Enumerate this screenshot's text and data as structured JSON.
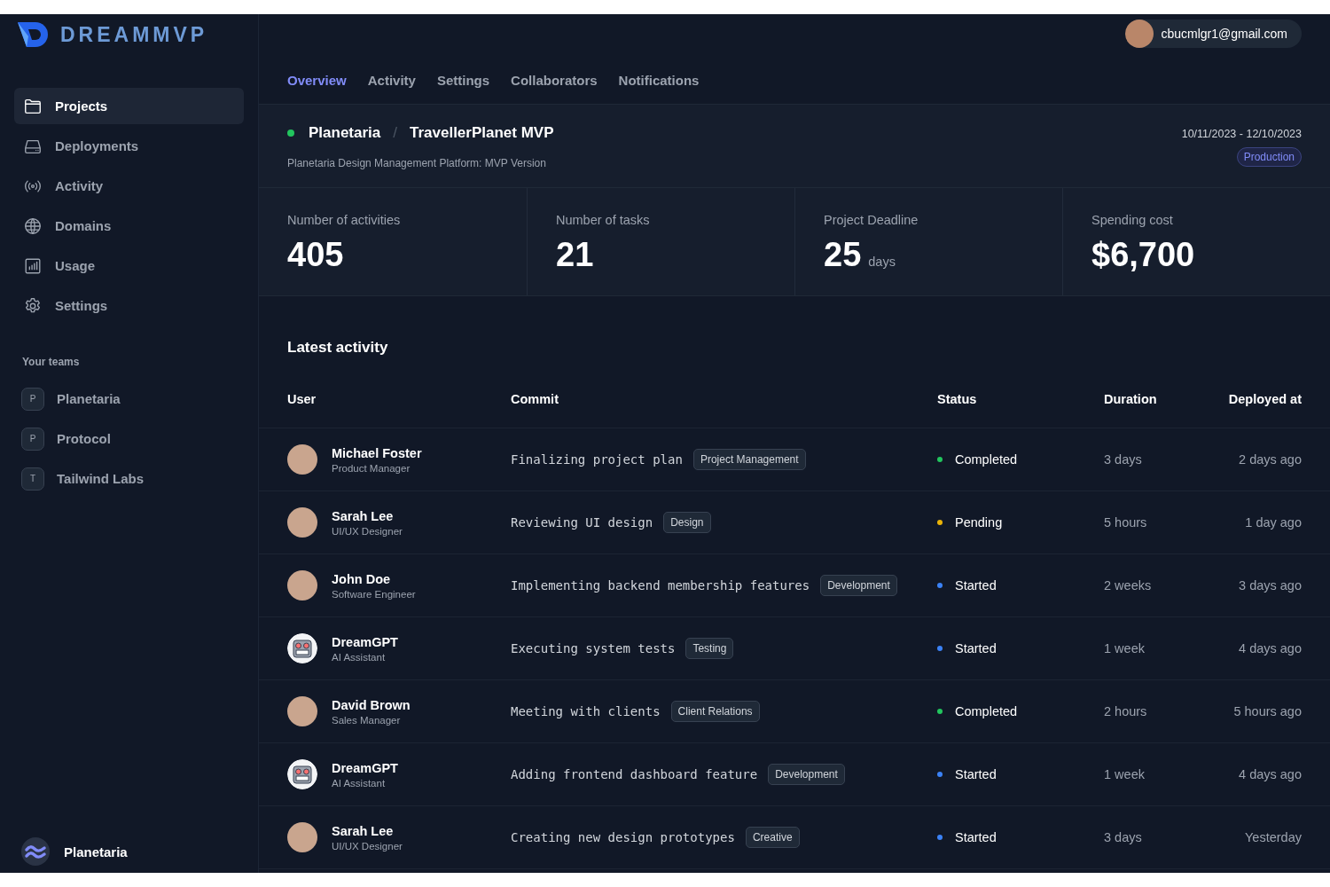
{
  "logo": {
    "text": "DREAMMVP"
  },
  "user_menu": {
    "email": "cbucmlgr1@gmail.com"
  },
  "sidebar": {
    "items": [
      {
        "label": "Projects",
        "selected": true
      },
      {
        "label": "Deployments",
        "selected": false
      },
      {
        "label": "Activity",
        "selected": false
      },
      {
        "label": "Domains",
        "selected": false
      },
      {
        "label": "Usage",
        "selected": false
      },
      {
        "label": "Settings",
        "selected": false
      }
    ],
    "teams_heading": "Your teams",
    "teams": [
      {
        "initial": "P",
        "name": "Planetaria"
      },
      {
        "initial": "P",
        "name": "Protocol"
      },
      {
        "initial": "T",
        "name": "Tailwind Labs"
      }
    ],
    "footer_team": "Planetaria"
  },
  "tabs": [
    {
      "label": "Overview",
      "selected": true
    },
    {
      "label": "Activity",
      "selected": false
    },
    {
      "label": "Settings",
      "selected": false
    },
    {
      "label": "Collaborators",
      "selected": false
    },
    {
      "label": "Notifications",
      "selected": false
    }
  ],
  "project": {
    "team": "Planetaria",
    "separator": "/",
    "name": "TravellerPlanet MVP",
    "description": "Planetaria Design Management Platform: MVP Version",
    "dates": "10/11/2023 - 12/10/2023",
    "environment": "Production"
  },
  "stats": [
    {
      "label": "Number of activities",
      "value": "405"
    },
    {
      "label": "Number of tasks",
      "value": "21"
    },
    {
      "label": "Project Deadline",
      "value": "25",
      "unit": "days"
    },
    {
      "label": "Spending cost",
      "value": "$6,700"
    }
  ],
  "activity": {
    "title": "Latest activity",
    "columns": [
      "User",
      "Commit",
      "Status",
      "Duration",
      "Deployed at"
    ],
    "rows": [
      {
        "kind": "person",
        "name": "Michael Foster",
        "role": "Product Manager",
        "commit": "Finalizing project plan",
        "tag": "Project Management",
        "status": "Completed",
        "color": "#22c55e",
        "duration": "3 days",
        "deployed": "2 days ago"
      },
      {
        "kind": "person",
        "name": "Sarah Lee",
        "role": "UI/UX Designer",
        "commit": "Reviewing UI design",
        "tag": "Design",
        "status": "Pending",
        "color": "#eab308",
        "duration": "5 hours",
        "deployed": "1 day ago"
      },
      {
        "kind": "person",
        "name": "John Doe",
        "role": "Software Engineer",
        "commit": "Implementing backend membership features",
        "tag": "Development",
        "status": "Started",
        "color": "#3b82f6",
        "duration": "2 weeks",
        "deployed": "3 days ago"
      },
      {
        "kind": "assistant",
        "name": "DreamGPT",
        "role": "AI Assistant",
        "commit": "Executing system tests",
        "tag": "Testing",
        "status": "Started",
        "color": "#3b82f6",
        "duration": "1 week",
        "deployed": "4 days ago"
      },
      {
        "kind": "person",
        "name": "David Brown",
        "role": "Sales Manager",
        "commit": "Meeting with clients",
        "tag": "Client Relations",
        "status": "Completed",
        "color": "#22c55e",
        "duration": "2 hours",
        "deployed": "5 hours ago"
      },
      {
        "kind": "assistant",
        "name": "DreamGPT",
        "role": "AI Assistant",
        "commit": "Adding frontend dashboard feature",
        "tag": "Development",
        "status": "Started",
        "color": "#3b82f6",
        "duration": "1 week",
        "deployed": "4 days ago"
      },
      {
        "kind": "person",
        "name": "Sarah Lee",
        "role": "UI/UX Designer",
        "commit": "Creating new design prototypes",
        "tag": "Creative",
        "status": "Started",
        "color": "#3b82f6",
        "duration": "3 days",
        "deployed": "Yesterday"
      }
    ]
  }
}
